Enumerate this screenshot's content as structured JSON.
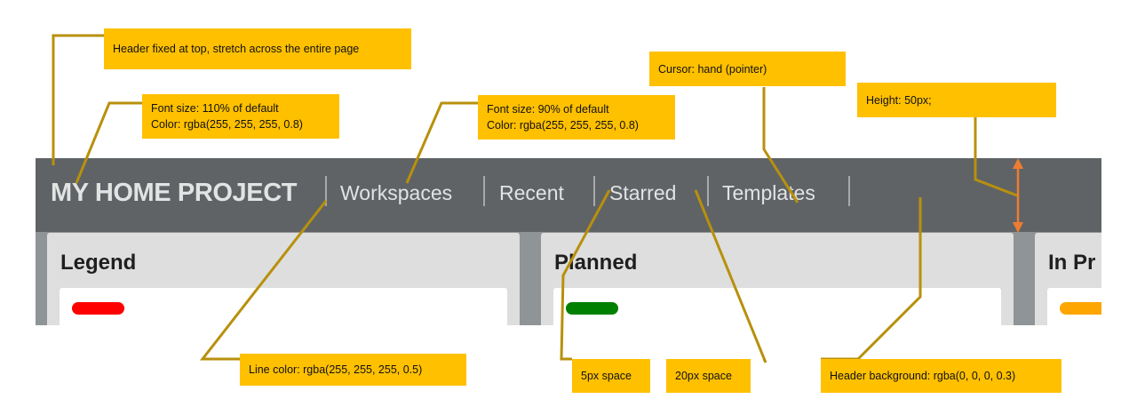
{
  "ui": {
    "project_title": "MY HOME PROJECT",
    "nav": [
      "Workspaces",
      "Recent",
      "Starred",
      "Templates"
    ],
    "columns": [
      {
        "title": "Legend",
        "label_color": "#ff0000"
      },
      {
        "title": "Planned",
        "label_color": "#008000"
      },
      {
        "title": "In Pr",
        "label_color": "#ffa500"
      }
    ]
  },
  "annotations": {
    "header_fixed": "Header fixed at top, stretch across the entire page",
    "title_font_line1": "Font size: 110% of default",
    "title_font_line2": "Color: rgba(255, 255, 255, 0.8)",
    "nav_font_line1": "Font size: 90% of default",
    "nav_font_line2": "Color: rgba(255, 255, 255, 0.8)",
    "cursor": "Cursor: hand (pointer)",
    "height": "Height: 50px;",
    "line_color": "Line color: rgba(255, 255, 255, 0.5)",
    "space_5": "5px space",
    "space_20": "20px space",
    "header_bg": "Header background: rgba(0, 0, 0, 0.3)"
  },
  "colors": {
    "annotation_fill": "#ffc000",
    "leader_line": "#b8900c",
    "height_arrow": "#ed7d31",
    "header_bg": "#5f6366",
    "board_bg": "#8f9497"
  }
}
